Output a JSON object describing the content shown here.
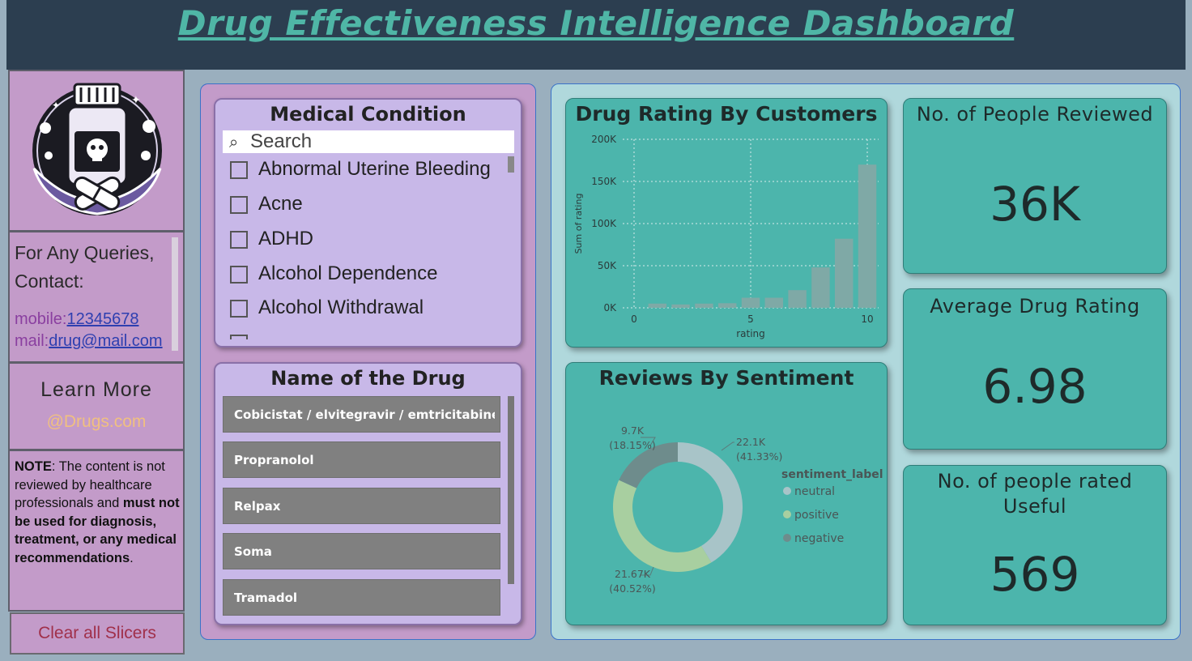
{
  "header": {
    "title": "Drug Effectiveness Intelligence Dashboard"
  },
  "sidebar": {
    "contact_heading": "For Any Queries, Contact:",
    "mobile_label": "mobile:",
    "mobile_value": "12345678",
    "mail_label": "mail:",
    "mail_value": "drug@mail.com",
    "learn_more": "Learn More",
    "learn_link": "@Drugs.com",
    "note_label": "NOTE",
    "note_text_1": ": The content is not reviewed by healthcare professionals and ",
    "note_text_bold": "must not be used for diagnosis, treatment, or any medical recommendations",
    "note_text_end": ".",
    "clear_button": "Clear all Slicers"
  },
  "medical_condition_slicer": {
    "title": "Medical Condition",
    "search_placeholder": "Search",
    "items": [
      "Abnormal Uterine Bleeding",
      "Acne",
      "ADHD",
      "Alcohol Dependence",
      "Alcohol Withdrawal"
    ]
  },
  "drug_slicer": {
    "title": "Name of the Drug",
    "items": [
      "Cobicistat / elvitegravir / emtricitabine / te...",
      "Propranolol",
      "Relpax",
      "Soma",
      "Tramadol"
    ]
  },
  "rating_chart": {
    "title": "Drug Rating By Customers"
  },
  "sentiment_chart": {
    "title": "Reviews By Sentiment"
  },
  "kpis": {
    "reviewed_label": "No. of People Reviewed",
    "reviewed_value": "36K",
    "avg_label": "Average Drug Rating",
    "avg_value": "6.98",
    "useful_label_1": "No. of people rated",
    "useful_label_2": "Useful",
    "useful_value": "569"
  },
  "colors": {
    "header_bg": "#2c3e50",
    "accent": "#4fb6a6",
    "card": "#4cb5ac",
    "sidebar": "#c39bc9",
    "slicer": "#c8b8e8"
  },
  "chart_data": [
    {
      "type": "bar",
      "title": "Drug Rating By Customers",
      "xlabel": "rating",
      "ylabel": "Sum of rating",
      "x": [
        1,
        2,
        3,
        4,
        5,
        6,
        7,
        8,
        9,
        10
      ],
      "values": [
        5000,
        4000,
        5000,
        5500,
        12000,
        12000,
        21000,
        48000,
        82000,
        170000
      ],
      "xlim": [
        0,
        10
      ],
      "ylim": [
        0,
        200000
      ],
      "x_ticks": [
        "0",
        "5",
        "10"
      ],
      "y_ticks": [
        "0K",
        "50K",
        "100K",
        "150K",
        "200K"
      ],
      "grid": true
    },
    {
      "type": "pie",
      "title": "Reviews By Sentiment",
      "legend_title": "sentiment_label",
      "legend_position": "right",
      "slices": [
        {
          "label": "neutral",
          "value": 22100,
          "value_label": "22.1K",
          "pct_label": "(41.33%)",
          "color": "#a8c4c8"
        },
        {
          "label": "positive",
          "value": 21670,
          "value_label": "21.67K",
          "pct_label": "(40.52%)",
          "color": "#a8cfa0"
        },
        {
          "label": "negative",
          "value": 9700,
          "value_label": "9.7K",
          "pct_label": "(18.15%)",
          "color": "#6e8c8c"
        }
      ]
    }
  ]
}
